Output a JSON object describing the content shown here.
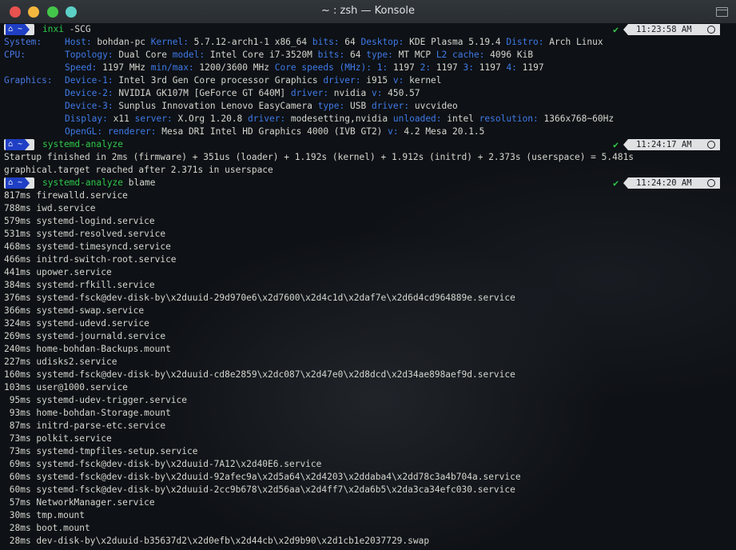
{
  "window": {
    "title": "~ : zsh — Konsole",
    "buttons": [
      {
        "name": "close-button",
        "color": "#e8524f"
      },
      {
        "name": "minimize-button",
        "color": "#f4b73e"
      },
      {
        "name": "maximize-button",
        "color": "#44c64a"
      },
      {
        "name": "keep-above-button",
        "color": "#5cd0c7"
      }
    ]
  },
  "prompt": {
    "home_glyph": "⌂ ~"
  },
  "prompts": [
    {
      "cmd": "inxi",
      "args": " -SCG",
      "time": "11:23:58 AM"
    },
    {
      "cmd": "systemd-analyze",
      "args": "",
      "time": "11:24:17 AM"
    },
    {
      "cmd": "systemd-analyze",
      "args": " blame",
      "time": "11:24:20 AM"
    }
  ],
  "inxi": [
    {
      "label": "System:",
      "parts": [
        {
          "k": "Host:",
          "v": " bohdan-pc "
        },
        {
          "k": "Kernel:",
          "v": " 5.7.12-arch1-1 x86_64 "
        },
        {
          "k": "bits:",
          "v": " 64 "
        },
        {
          "k": "Desktop:",
          "v": " KDE Plasma 5.19.4 "
        },
        {
          "k": "Distro:",
          "v": " Arch Linux"
        }
      ]
    },
    {
      "label": "CPU:",
      "parts": [
        {
          "k": "Topology:",
          "v": " Dual Core "
        },
        {
          "k": "model:",
          "v": " Intel Core i7-3520M "
        },
        {
          "k": "bits:",
          "v": " 64 "
        },
        {
          "k": "type:",
          "v": " MT MCP "
        },
        {
          "k": "L2 cache:",
          "v": " 4096 KiB"
        }
      ]
    },
    {
      "label": "",
      "parts": [
        {
          "k": "Speed:",
          "v": " 1197 MHz "
        },
        {
          "k": "min/max:",
          "v": " 1200/3600 MHz "
        },
        {
          "k": "Core speeds (MHz):",
          "v": " "
        },
        {
          "k": "1:",
          "v": " 1197 "
        },
        {
          "k": "2:",
          "v": " 1197 "
        },
        {
          "k": "3:",
          "v": " 1197 "
        },
        {
          "k": "4:",
          "v": " 1197"
        }
      ]
    },
    {
      "label": "Graphics:",
      "parts": [
        {
          "k": "Device-1:",
          "v": " Intel 3rd Gen Core processor Graphics "
        },
        {
          "k": "driver:",
          "v": " i915 "
        },
        {
          "k": "v:",
          "v": " kernel"
        }
      ]
    },
    {
      "label": "",
      "parts": [
        {
          "k": "Device-2:",
          "v": " NVIDIA GK107M [GeForce GT 640M] "
        },
        {
          "k": "driver:",
          "v": " nvidia "
        },
        {
          "k": "v:",
          "v": " 450.57"
        }
      ]
    },
    {
      "label": "",
      "parts": [
        {
          "k": "Device-3:",
          "v": " Sunplus Innovation Lenovo EasyCamera "
        },
        {
          "k": "type:",
          "v": " USB "
        },
        {
          "k": "driver:",
          "v": " uvcvideo"
        }
      ]
    },
    {
      "label": "",
      "parts": [
        {
          "k": "Display:",
          "v": " x11 "
        },
        {
          "k": "server:",
          "v": " X.Org 1.20.8 "
        },
        {
          "k": "driver:",
          "v": " modesetting,nvidia "
        },
        {
          "k": "unloaded:",
          "v": " intel "
        },
        {
          "k": "resolution:",
          "v": " 1366x768~60Hz"
        }
      ]
    },
    {
      "label": "",
      "parts": [
        {
          "k": "OpenGL:",
          "v": " "
        },
        {
          "k": "renderer:",
          "v": " Mesa DRI Intel HD Graphics 4000 (IVB GT2) "
        },
        {
          "k": "v:",
          "v": " 4.2 Mesa 20.1.5"
        }
      ]
    }
  ],
  "analyze_output": [
    "Startup finished in 2ms (firmware) + 351us (loader) + 1.192s (kernel) + 1.912s (initrd) + 2.373s (userspace) = 5.481s",
    "graphical.target reached after 2.371s in userspace"
  ],
  "blame": [
    "817ms firewalld.service",
    "788ms iwd.service",
    "579ms systemd-logind.service",
    "531ms systemd-resolved.service",
    "468ms systemd-timesyncd.service",
    "466ms initrd-switch-root.service",
    "441ms upower.service",
    "384ms systemd-rfkill.service",
    "376ms systemd-fsck@dev-disk-by\\x2duuid-29d970e6\\x2d7600\\x2d4c1d\\x2daf7e\\x2d6d4cd964889e.service",
    "366ms systemd-swap.service",
    "324ms systemd-udevd.service",
    "269ms systemd-journald.service",
    "240ms home-bohdan-Backups.mount",
    "227ms udisks2.service",
    "160ms systemd-fsck@dev-disk-by\\x2duuid-cd8e2859\\x2dc087\\x2d47e0\\x2d8dcd\\x2d34ae898aef9d.service",
    "103ms user@1000.service",
    " 95ms systemd-udev-trigger.service",
    " 93ms home-bohdan-Storage.mount",
    " 87ms initrd-parse-etc.service",
    " 73ms polkit.service",
    " 73ms systemd-tmpfiles-setup.service",
    " 69ms systemd-fsck@dev-disk-by\\x2duuid-7A12\\x2d40E6.service",
    " 60ms systemd-fsck@dev-disk-by\\x2duuid-92afec9a\\x2d5a64\\x2d4203\\x2ddaba4\\x2dd78c3a4b704a.service",
    " 60ms systemd-fsck@dev-disk-by\\x2duuid-2cc9b678\\x2d56aa\\x2d4ff7\\x2da6b5\\x2da3ca34efc030.service",
    " 57ms NetworkManager.service",
    " 30ms tmp.mount",
    " 28ms boot.mount",
    " 28ms dev-disk-by\\x2duuid-b35637d2\\x2d0efb\\x2d44cb\\x2d9b90\\x2d1cb1e2037729.swap"
  ]
}
